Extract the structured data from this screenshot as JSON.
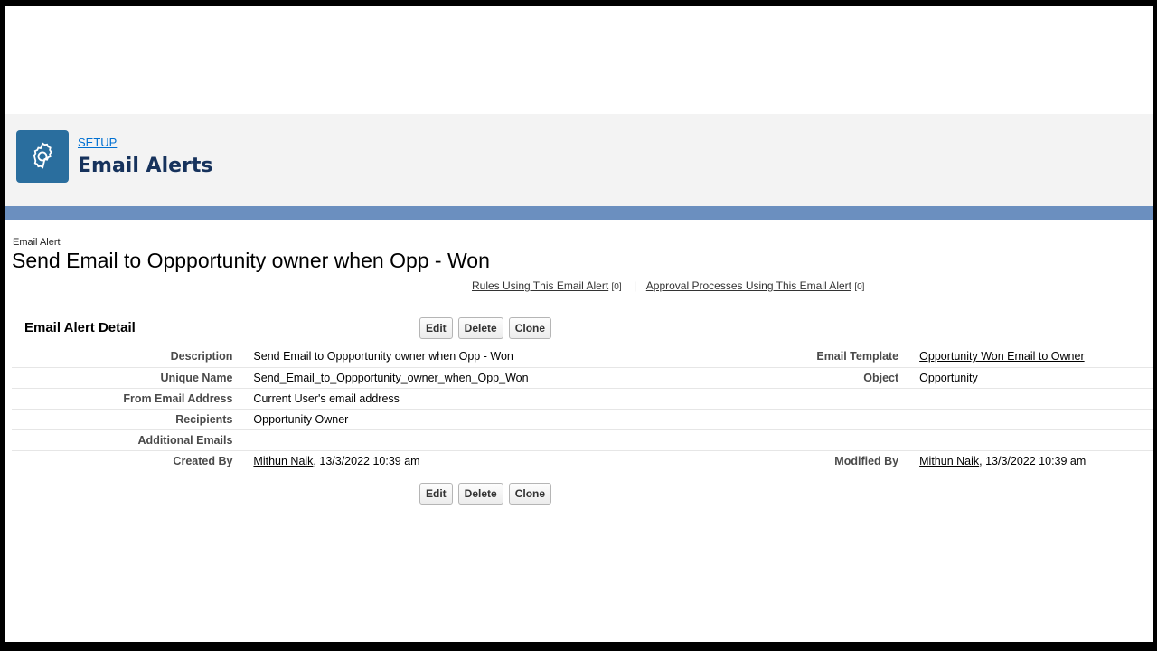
{
  "header": {
    "breadcrumb": "SETUP",
    "title": "Email Alerts",
    "icon": "gear-icon",
    "accent": "#2a6e9e"
  },
  "record": {
    "type": "Email Alert",
    "name": "Send Email to Oppportunity owner when Opp - Won"
  },
  "related": {
    "rules_label": "Rules Using This Email Alert",
    "rules_count": "[0]",
    "separator": "|",
    "approval_label": "Approval Processes Using This Email Alert",
    "approval_count": "[0]"
  },
  "section": {
    "title": "Email Alert Detail"
  },
  "buttons": {
    "edit": "Edit",
    "delete": "Delete",
    "clone": "Clone"
  },
  "fields": {
    "description_label": "Description",
    "description_value": "Send Email to Oppportunity owner when Opp - Won",
    "email_template_label": "Email Template",
    "email_template_value": "Opportunity Won Email to Owner",
    "unique_name_label": "Unique Name",
    "unique_name_value": "Send_Email_to_Oppportunity_owner_when_Opp_Won",
    "object_label": "Object",
    "object_value": "Opportunity",
    "from_email_label": "From Email Address",
    "from_email_value": "Current User's email address",
    "recipients_label": "Recipients",
    "recipients_value": "Opportunity Owner",
    "additional_emails_label": "Additional Emails",
    "additional_emails_value": "",
    "created_by_label": "Created By",
    "created_by_user": "Mithun Naik",
    "created_by_date": ", 13/3/2022 10:39 am",
    "modified_by_label": "Modified By",
    "modified_by_user": "Mithun Naik",
    "modified_by_date": ", 13/3/2022 10:39 am"
  }
}
